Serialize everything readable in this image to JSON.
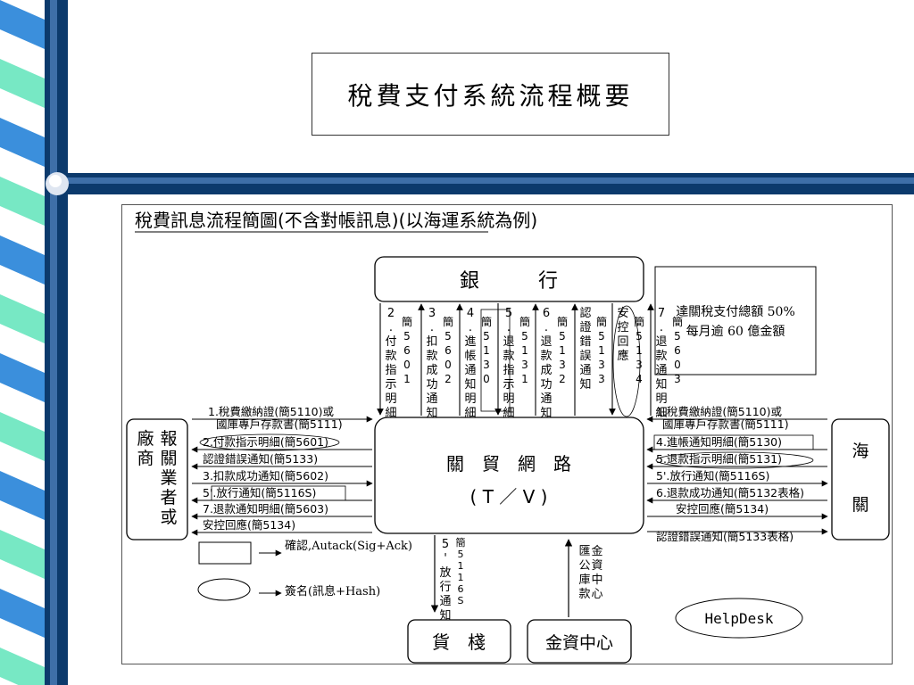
{
  "slide_title": "稅費支付系統流程概要",
  "diagram": {
    "title": "稅費訊息流程簡圖(不含對帳訊息)(以海運系統為例)",
    "bank_label": "銀　　　行",
    "network_label": "關　貿　網　路",
    "network_sub": "( T ／ V )",
    "broker_label_col1": "報關業者或",
    "broker_label_col2": "廠商",
    "customs_label": "海關",
    "warehouse_label": "貨　棧",
    "treasury_label": "金資中心",
    "note_line1": "達關稅支付總額 50%",
    "note_line2": "每月逾 60 億金額",
    "legend_ack": "確認,Autack(Sig+Ack)",
    "legend_sig": "簽名(訊息+Hash)",
    "helpdesk": "HelpDesk",
    "bank_columns": [
      "2.付款指示明細",
      "簡5601",
      "3.扣款成功通知",
      "簡5602",
      "4.進帳通知明細",
      "簡5130",
      "5.退款指示明細",
      "簡5131",
      "6.退款成功通知",
      "簡5132",
      "認證錯誤通知",
      "簡5133",
      "安控回應",
      "簡5134",
      "7.退款通知明細",
      "簡5603"
    ],
    "left_messages": [
      "1.稅費繳納證(簡5110)或",
      "國庫專戶存款書(簡5111)",
      "2.付款指示明細(簡5601)",
      "認證錯誤通知(簡5133)",
      "3.扣款成功通知(簡5602)",
      "5'.放行通知(簡5116S)",
      "7.退款通知明細(簡5603)",
      "安控回應(簡5134)"
    ],
    "right_messages": [
      "1.稅費繳納證(簡5110)或",
      "國庫專戶存款書(簡5111)",
      "4.進帳通知明細(簡5130)",
      "5.退款指示明細(簡5131)",
      "5'.放行通知(簡5116S)",
      "6.退款成功通知(簡5132表格)",
      "安控回應(簡5134)",
      "認證錯誤通知(簡5133表格)"
    ],
    "warehouse_msg": "5'放行通知",
    "warehouse_msg_code": "簡5116S",
    "treasury_msg": "金資中心匯公庫款"
  }
}
